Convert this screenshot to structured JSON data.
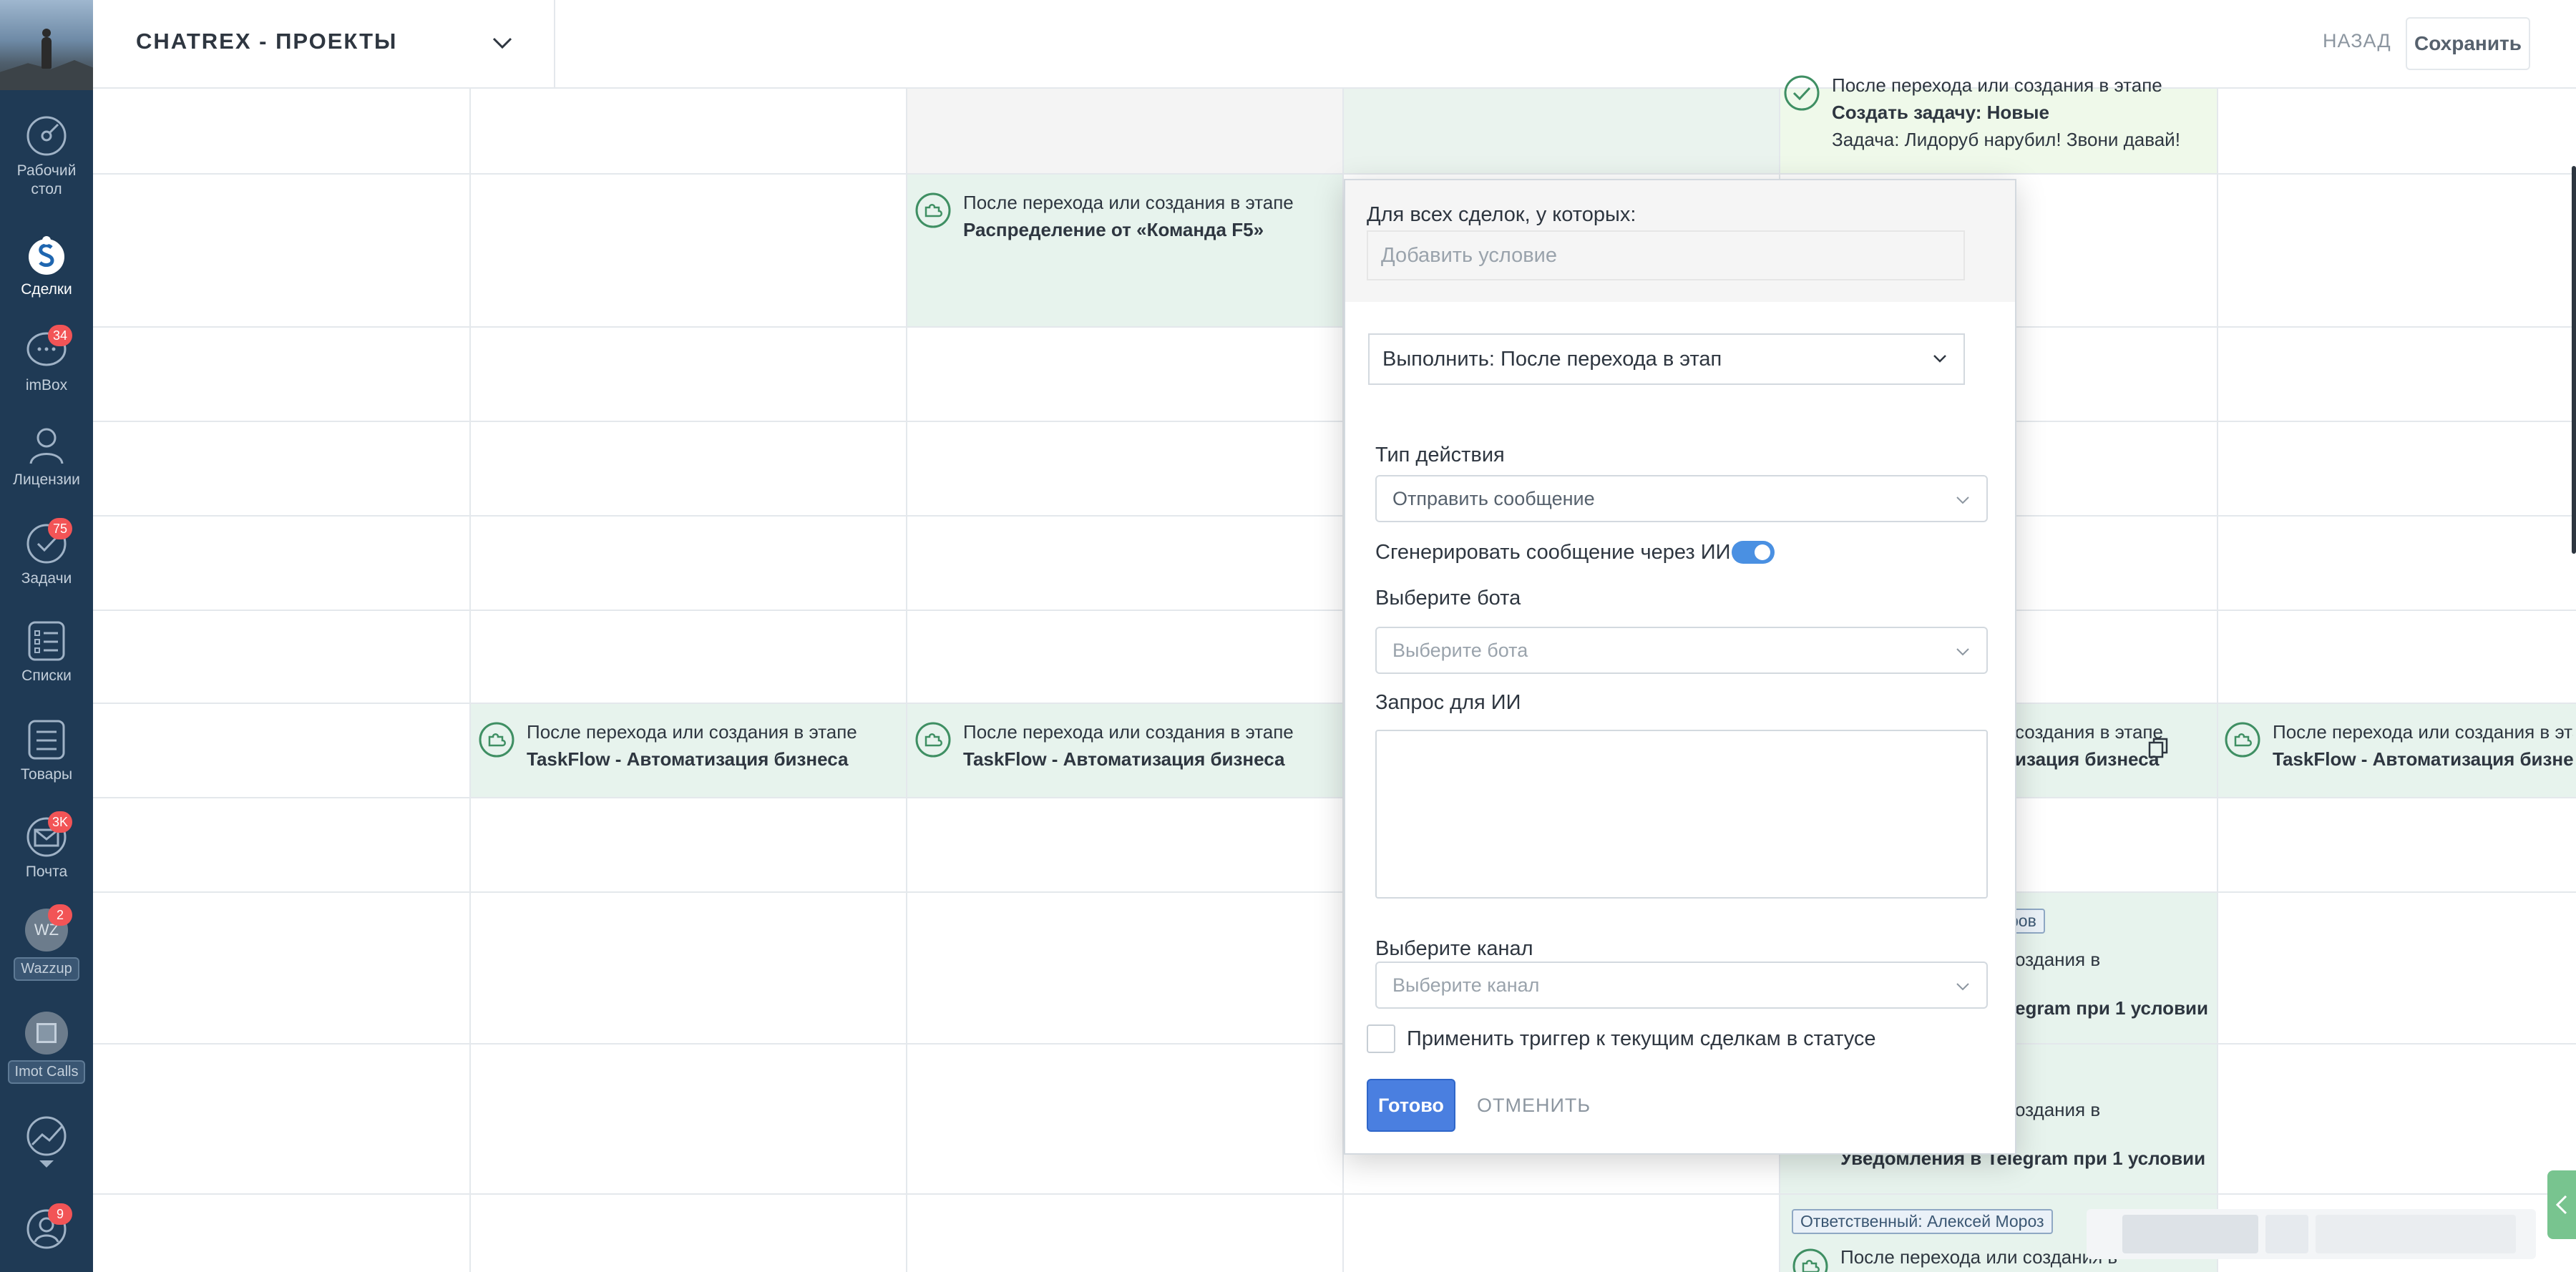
{
  "sidebar": {
    "items": [
      {
        "label": "Рабочий\nстол",
        "icon": "dashboard-icon",
        "badge": ""
      },
      {
        "label": "Сделки",
        "icon": "deals-icon",
        "badge": ""
      },
      {
        "label": "imBox",
        "icon": "chat-icon",
        "badge": "34"
      },
      {
        "label": "Лицензии",
        "icon": "license-icon",
        "badge": ""
      },
      {
        "label": "Задачи",
        "icon": "tasks-icon",
        "badge": "75"
      },
      {
        "label": "Списки",
        "icon": "lists-icon",
        "badge": ""
      },
      {
        "label": "Товары",
        "icon": "products-icon",
        "badge": ""
      },
      {
        "label": "Почта",
        "icon": "mail-icon",
        "badge": "3K"
      },
      {
        "label": "Wazzup",
        "icon": "wazzup-icon",
        "badge": "2",
        "avatar_text": "WZ"
      },
      {
        "label": "Imot Calls",
        "icon": "calls-icon",
        "badge": ""
      },
      {
        "label": "",
        "icon": "analytics-icon",
        "badge": ""
      },
      {
        "label": "",
        "icon": "profile-icon",
        "badge": "9"
      }
    ]
  },
  "header": {
    "pipeline_title": "CHATREX - ПРОЕКТЫ",
    "back_label": "НАЗАД",
    "save_label": "Сохранить"
  },
  "board": {
    "triggers": [
      {
        "line1": "После перехода или создания в этапе",
        "line2": "Распределение от «Команда F5»"
      },
      {
        "line1": "После перехода или создания в этапе",
        "line2": "TaskFlow - Автоматизация бизнеса"
      },
      {
        "line1": "После перехода или создания в этапе",
        "line2": "TaskFlow - Автоматизация бизнеса"
      },
      {
        "line1": "После перехода или создания в этапе",
        "line2": "TaskFlow - Автоматизация бизнеса"
      }
    ],
    "top_task": {
      "line1": "После перехода или создания в этапе",
      "line2": "Создать задачу: Новые",
      "line3": "Задача: Лидоруб нарубил! Звони давай!"
    },
    "fragments": {
      "trig_right_line1": "создания в этапе",
      "trig_right_line2": "изация бизнеса",
      "tag_partial": "ров",
      "notif1_line1": "оздания в",
      "notif1_line2": "egram при 1 условии",
      "notif2_line1": "оздания в",
      "notif2_line2": "Уведомления в Telegram при 1 условии",
      "tag_responsible": "Ответственный: Алексей Мороз",
      "bottom_line1": "После перехода или создания в"
    }
  },
  "modal": {
    "all_deals_label": "Для всех сделок, у которых:",
    "condition_placeholder": "Добавить условие",
    "execute_value": "Выполнить: После перехода в этап",
    "action_type_label": "Тип действия",
    "action_type_value": "Отправить сообщение",
    "ai_toggle_label": "Сгенерировать сообщение через ИИ",
    "ai_toggle_on": true,
    "bot_label": "Выберите бота",
    "bot_placeholder": "Выберите бота",
    "ai_request_label": "Запрос для ИИ",
    "ai_request_value": "",
    "channel_label": "Выберите канал",
    "channel_placeholder": "Выберите канал",
    "apply_existing_label": "Применить триггер к текущим сделкам в статусе",
    "done_label": "Готово",
    "cancel_label": "ОТМЕНИТЬ"
  },
  "colors": {
    "sidebar_bg": "#1f3a55",
    "badge": "#f25456",
    "accent_blue": "#4a7fe0",
    "toggle_on": "#4a90e2",
    "cell_green": "#e7f3ed",
    "cell_gray": "#f4f4f4",
    "cell_light_green": "#eef8e8"
  }
}
